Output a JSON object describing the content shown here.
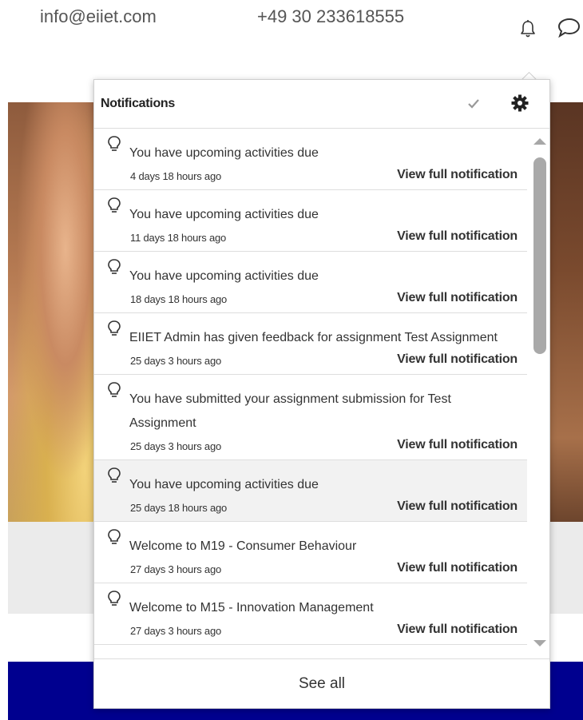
{
  "header": {
    "email": "info@eiiet.com",
    "phone": "+49 30 233618555",
    "icons": [
      "bell-icon",
      "chat-icon"
    ]
  },
  "notifications": {
    "title": "Notifications",
    "icons": [
      "check-icon",
      "gear-icon",
      "bulb-icon"
    ],
    "items": [
      {
        "text": "You have upcoming activities due",
        "time": "4 days 18 hours ago",
        "link": "View full notification"
      },
      {
        "text": "You have upcoming activities due",
        "time": "11 days 18 hours ago",
        "link": "View full notification"
      },
      {
        "text": "You have upcoming activities due",
        "time": "18 days 18 hours ago",
        "link": "View full notification"
      },
      {
        "text": "EIIET Admin has given feedback for assignment Test Assignment",
        "time": "25 days 3 hours ago",
        "link": "View full notification"
      },
      {
        "text": "You have submitted your assignment submission for Test Assignment",
        "time": "25 days 3 hours ago",
        "link": "View full notification"
      },
      {
        "text": "You have upcoming activities due",
        "time": "25 days 18 hours ago",
        "link": "View full notification"
      },
      {
        "text": "Welcome to M19 - Consumer Behaviour",
        "time": "27 days 3 hours ago",
        "link": "View full notification"
      },
      {
        "text": "Welcome to M15 - Innovation Management",
        "time": "27 days 3 hours ago",
        "link": "View full notification"
      }
    ],
    "see_all": "See all"
  },
  "colors": {
    "footer_band": "#00008f",
    "gray_band": "#ebebeb"
  }
}
